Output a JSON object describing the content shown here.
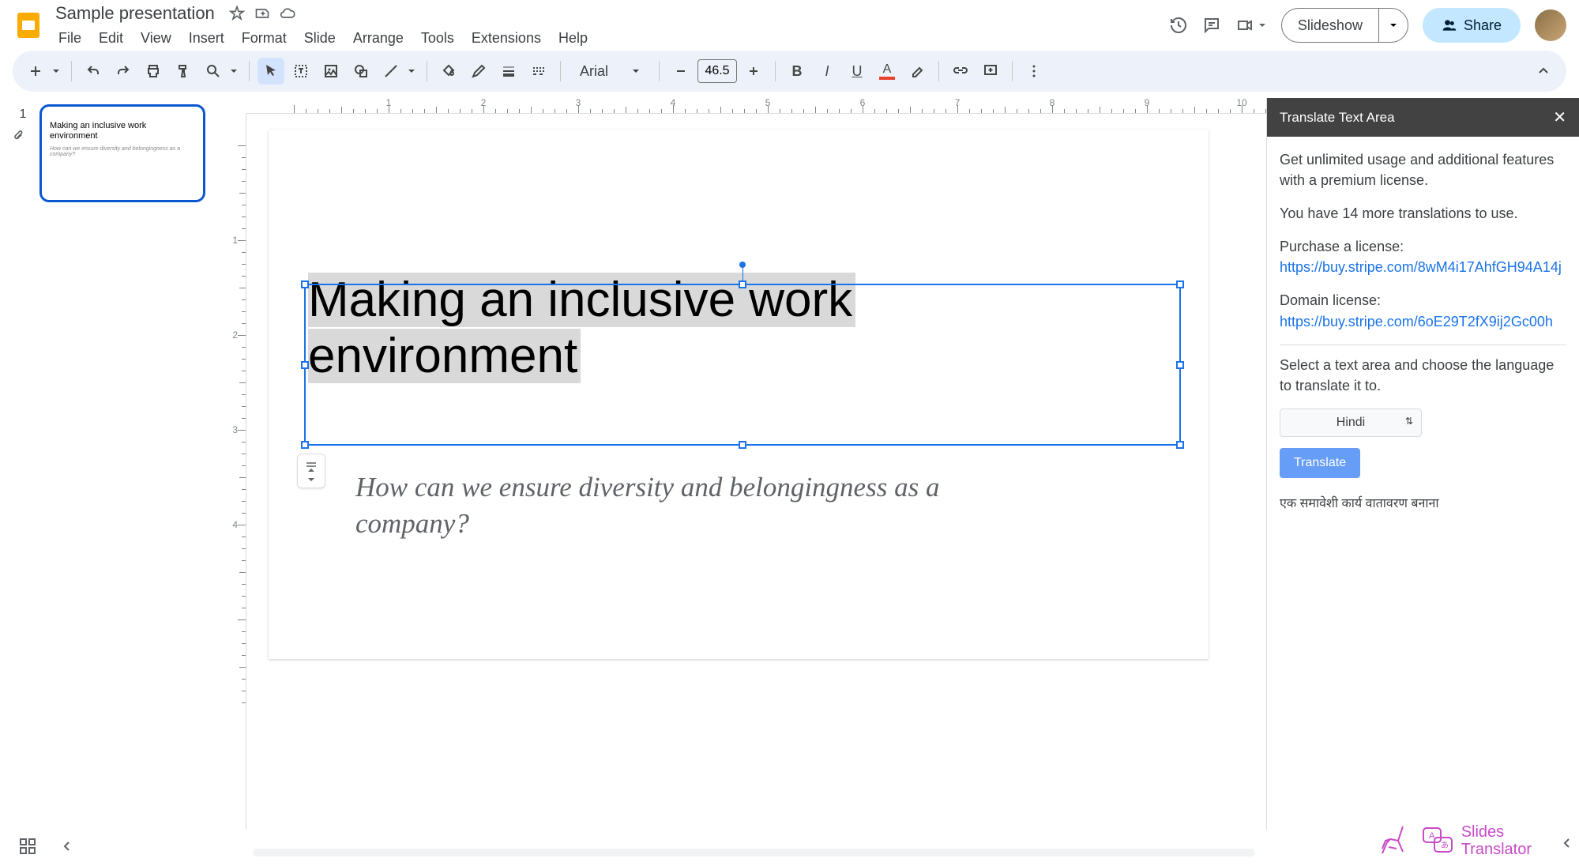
{
  "header": {
    "title": "Sample presentation",
    "menus": [
      "File",
      "Edit",
      "View",
      "Insert",
      "Format",
      "Slide",
      "Arrange",
      "Tools",
      "Extensions",
      "Help"
    ],
    "slideshow": "Slideshow",
    "share": "Share"
  },
  "toolbar": {
    "font": "Arial",
    "font_size": "46.5"
  },
  "thumbnails": {
    "slide1_num": "1",
    "slide1_title": "Making an inclusive work environment",
    "slide1_sub": "How can we ensure diversity and belongingness as a company?"
  },
  "slide": {
    "title_line1": "Making an inclusive work",
    "title_line2": "environment",
    "subtitle": "How can we ensure diversity and belongingness as a company?"
  },
  "sidepanel": {
    "title": "Translate Text Area",
    "promo": "Get unlimited usage and additional features with a premium license.",
    "remaining": "You have 14 more translations to use.",
    "purchase_label": "Purchase a license:",
    "purchase_link": "https://buy.stripe.com/8wM4i17AhfGH94A14j",
    "domain_label": "Domain license:",
    "domain_link": "https://buy.stripe.com/6oE29T2fX9ij2Gc00h",
    "instruction": "Select a text area and choose the language to translate it to.",
    "language": "Hindi",
    "translate_btn": "Translate",
    "result": "एक समावेशी कार्य वातावरण बनाना",
    "brand1": "Slides",
    "brand2": "Translator"
  },
  "ruler": {
    "h": [
      "1",
      "2",
      "3",
      "4",
      "5",
      "6",
      "7",
      "8",
      "9",
      "10"
    ],
    "v": [
      "1",
      "2",
      "3",
      "4"
    ]
  }
}
